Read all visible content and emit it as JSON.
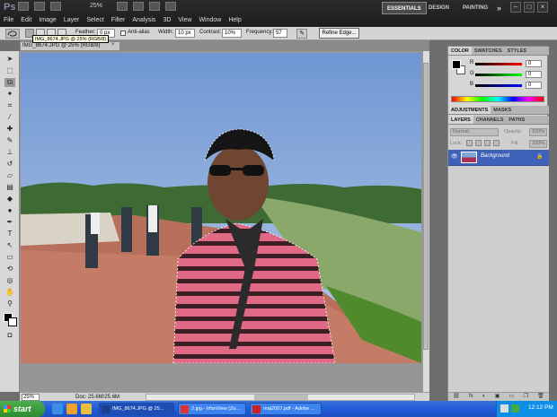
{
  "app": {
    "logo": "Ps"
  },
  "menu": [
    "File",
    "Edit",
    "Image",
    "Layer",
    "Select",
    "Filter",
    "Analysis",
    "3D",
    "View",
    "Window",
    "Help"
  ],
  "zoom_top": "25%",
  "workspaces": {
    "essentials": "ESSENTIALS",
    "design": "DESIGN",
    "painting": "PAINTING",
    "more": "»"
  },
  "window_controls": {
    "minimize": "–",
    "restore": "□",
    "close": "×"
  },
  "options": {
    "feather_label": "Feather:",
    "feather_value": "0 px",
    "antialias_label": "Anti-alias",
    "width_label": "Width:",
    "width_value": "10 px",
    "contrast_label": "Contrast:",
    "contrast_value": "10%",
    "frequency_label": "Frequency:",
    "frequency_value": "57",
    "refine_edge": "Refine Edge..."
  },
  "tooltip": "IMG_8674.JPG @ 25% (RGB/8)",
  "document": {
    "tab": "IMG_8674.JPG @ 25% (RGB/8)",
    "close": "×"
  },
  "status": {
    "zoom": "25%",
    "doc": "Doc: 25.6M/25.6M"
  },
  "panels": {
    "color_tabs": [
      "COLOR",
      "SWATCHES",
      "STYLES"
    ],
    "r_label": "R",
    "g_label": "G",
    "b_label": "B",
    "r_value": "0",
    "g_value": "0",
    "b_value": "0",
    "adjust_tabs": [
      "ADJUSTMENTS",
      "MASKS"
    ],
    "layer_tabs": [
      "LAYERS",
      "CHANNELS",
      "PATHS"
    ],
    "blend_mode": "Normal",
    "opacity_label": "Opacity:",
    "opacity_value": "100%",
    "lock_label": "Lock:",
    "fill_label": "Fill:",
    "fill_value": "100%",
    "layer_name": "Background",
    "footer": [
      "⛓",
      "fx",
      "◐",
      "▣",
      "▭",
      "❐",
      "🗑"
    ]
  },
  "taskbar": {
    "start": "start",
    "tasks": [
      "IMG_8674.JPG @ 25...",
      "2.jpg - IrfanView (Zo...",
      "mat2007.pdf - Adobe ..."
    ],
    "clock": "12:12 PM"
  },
  "colors": {
    "accent": "#3f62b8",
    "taskbar": "#245edb",
    "start": "#2e8b2e"
  }
}
